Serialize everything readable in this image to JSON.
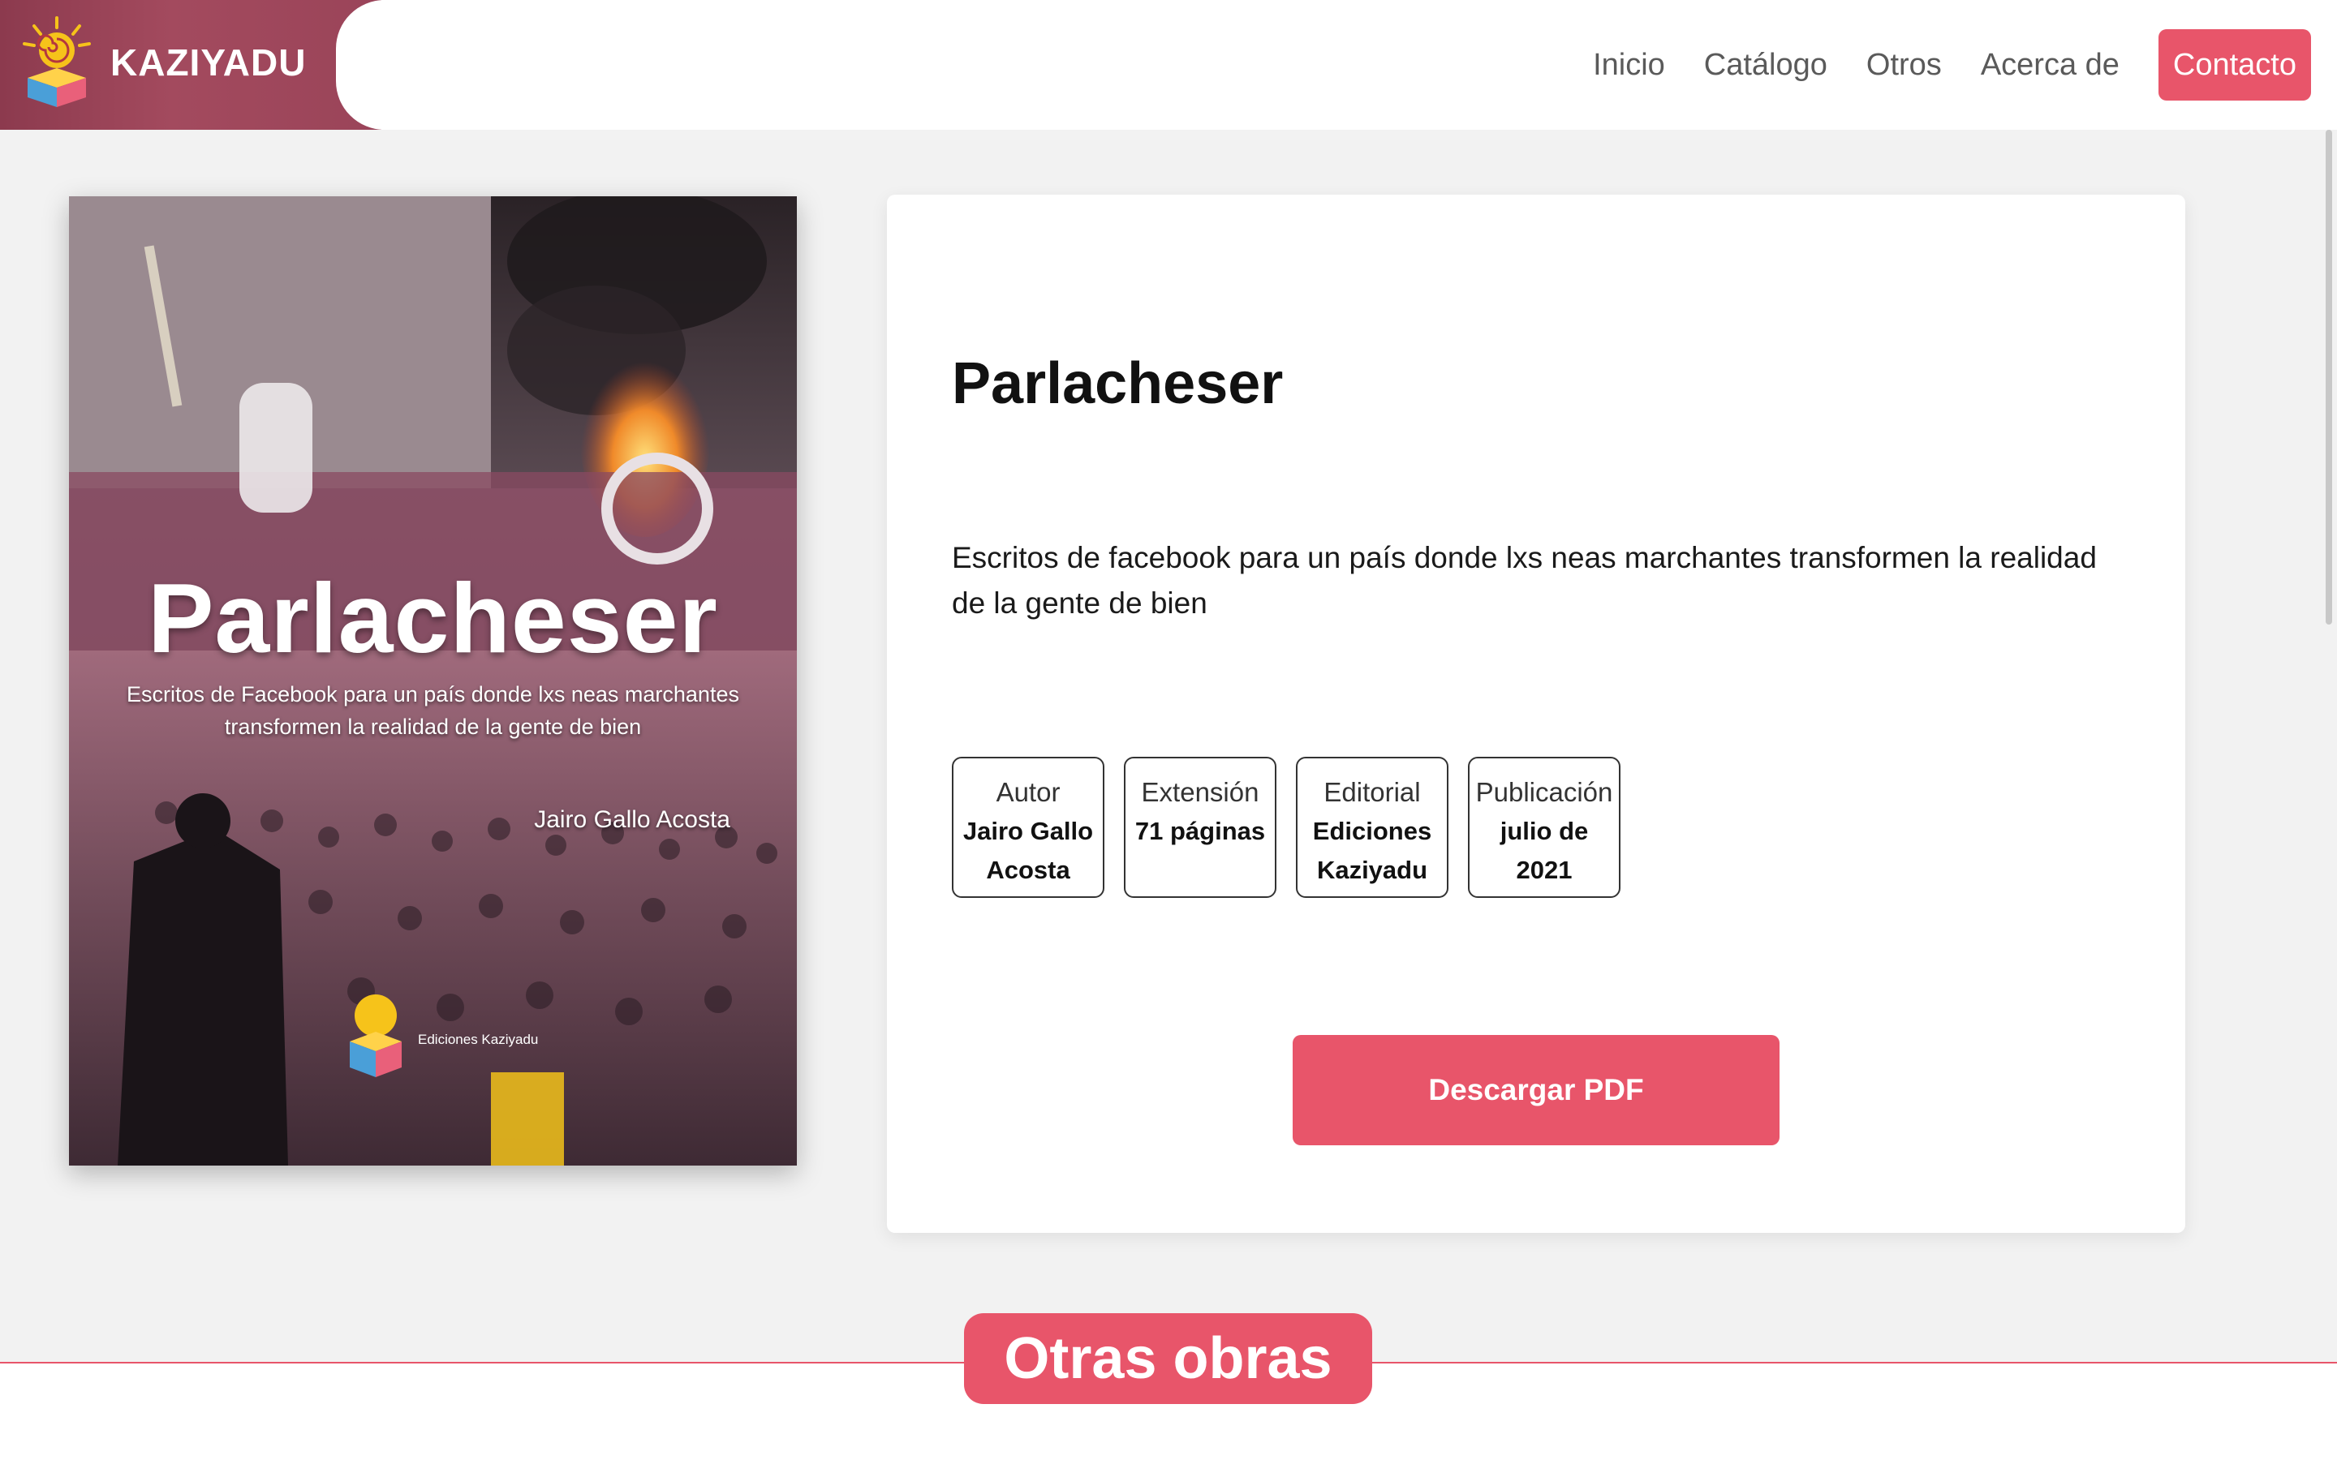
{
  "header": {
    "brand_name": "KAZIYADU",
    "nav": [
      "Inicio",
      "Catálogo",
      "Otros",
      "Acerca de"
    ],
    "contact": "Contacto"
  },
  "cover": {
    "title": "Parlacheser",
    "subtitle": "Escritos de Facebook para un país donde lxs neas marchantes transformen la realidad de la gente de bien",
    "author": "Jairo Gallo Acosta",
    "publisher": "Ediciones Kaziyadu"
  },
  "book": {
    "title": "Parlacheser",
    "description": "Escritos de facebook para un país donde lxs neas marchantes transformen la realidad de la gente de bien",
    "meta": [
      {
        "label": "Autor",
        "value": "Jairo Gallo Acosta"
      },
      {
        "label": "Extensión",
        "value": "71 páginas"
      },
      {
        "label": "Editorial",
        "value": "Ediciones Kaziyadu"
      },
      {
        "label": "Publicación",
        "value": "julio de 2021"
      }
    ],
    "download_label": "Descargar PDF"
  },
  "section": {
    "other_works": "Otras obras"
  },
  "colors": {
    "accent": "#e8556a",
    "brand_bg": "#9a4459",
    "page_bg": "#f2f2f2"
  },
  "icons": {
    "logo": "kaziyadu-logo-icon"
  }
}
